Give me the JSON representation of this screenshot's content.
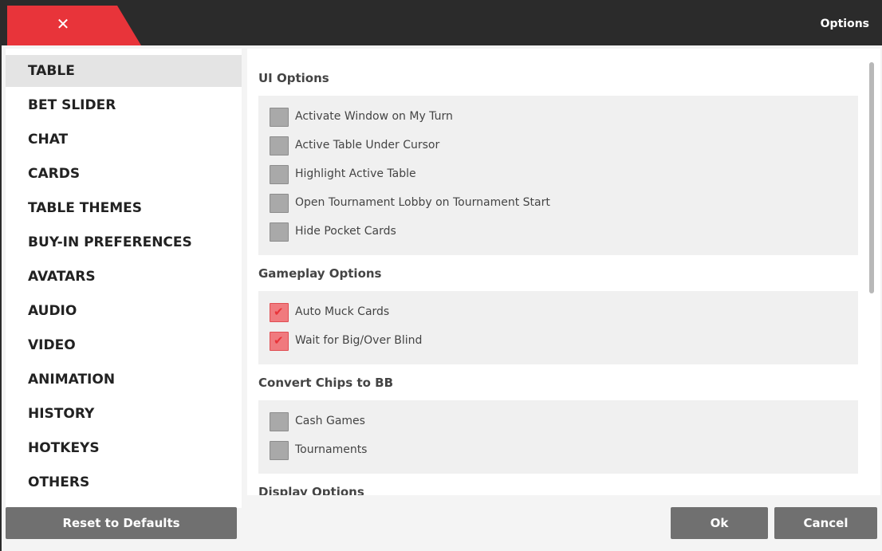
{
  "title_bar": {
    "close_glyph": "✕",
    "title": "Options",
    "accent_color": "#e8343a"
  },
  "sidebar": {
    "items": [
      {
        "label": "TABLE",
        "active": true
      },
      {
        "label": "BET SLIDER"
      },
      {
        "label": "CHAT"
      },
      {
        "label": "CARDS"
      },
      {
        "label": "TABLE THEMES"
      },
      {
        "label": "BUY-IN PREFERENCES"
      },
      {
        "label": "AVATARS"
      },
      {
        "label": "AUDIO"
      },
      {
        "label": "VIDEO"
      },
      {
        "label": "ANIMATION"
      },
      {
        "label": "HISTORY"
      },
      {
        "label": "HOTKEYS"
      },
      {
        "label": "OTHERS"
      }
    ],
    "reset_label": "Reset to Defaults"
  },
  "sections": {
    "ui": {
      "title": "UI Options",
      "options": [
        {
          "label": "Activate Window on My Turn",
          "checked": false
        },
        {
          "label": "Active Table Under Cursor",
          "checked": false
        },
        {
          "label": "Highlight Active Table",
          "checked": false
        },
        {
          "label": "Open Tournament Lobby on Tournament Start",
          "checked": false
        },
        {
          "label": "Hide Pocket Cards",
          "checked": false
        }
      ]
    },
    "gameplay": {
      "title": "Gameplay Options",
      "options": [
        {
          "label": "Auto Muck Cards",
          "checked": true
        },
        {
          "label": "Wait for Big/Over Blind",
          "checked": true
        }
      ]
    },
    "convert": {
      "title": "Convert Chips to BB",
      "options": [
        {
          "label": "Cash Games",
          "checked": false
        },
        {
          "label": "Tournaments",
          "checked": false
        }
      ]
    },
    "display": {
      "title": "Display Options"
    }
  },
  "footer": {
    "ok_label": "Ok",
    "cancel_label": "Cancel"
  }
}
